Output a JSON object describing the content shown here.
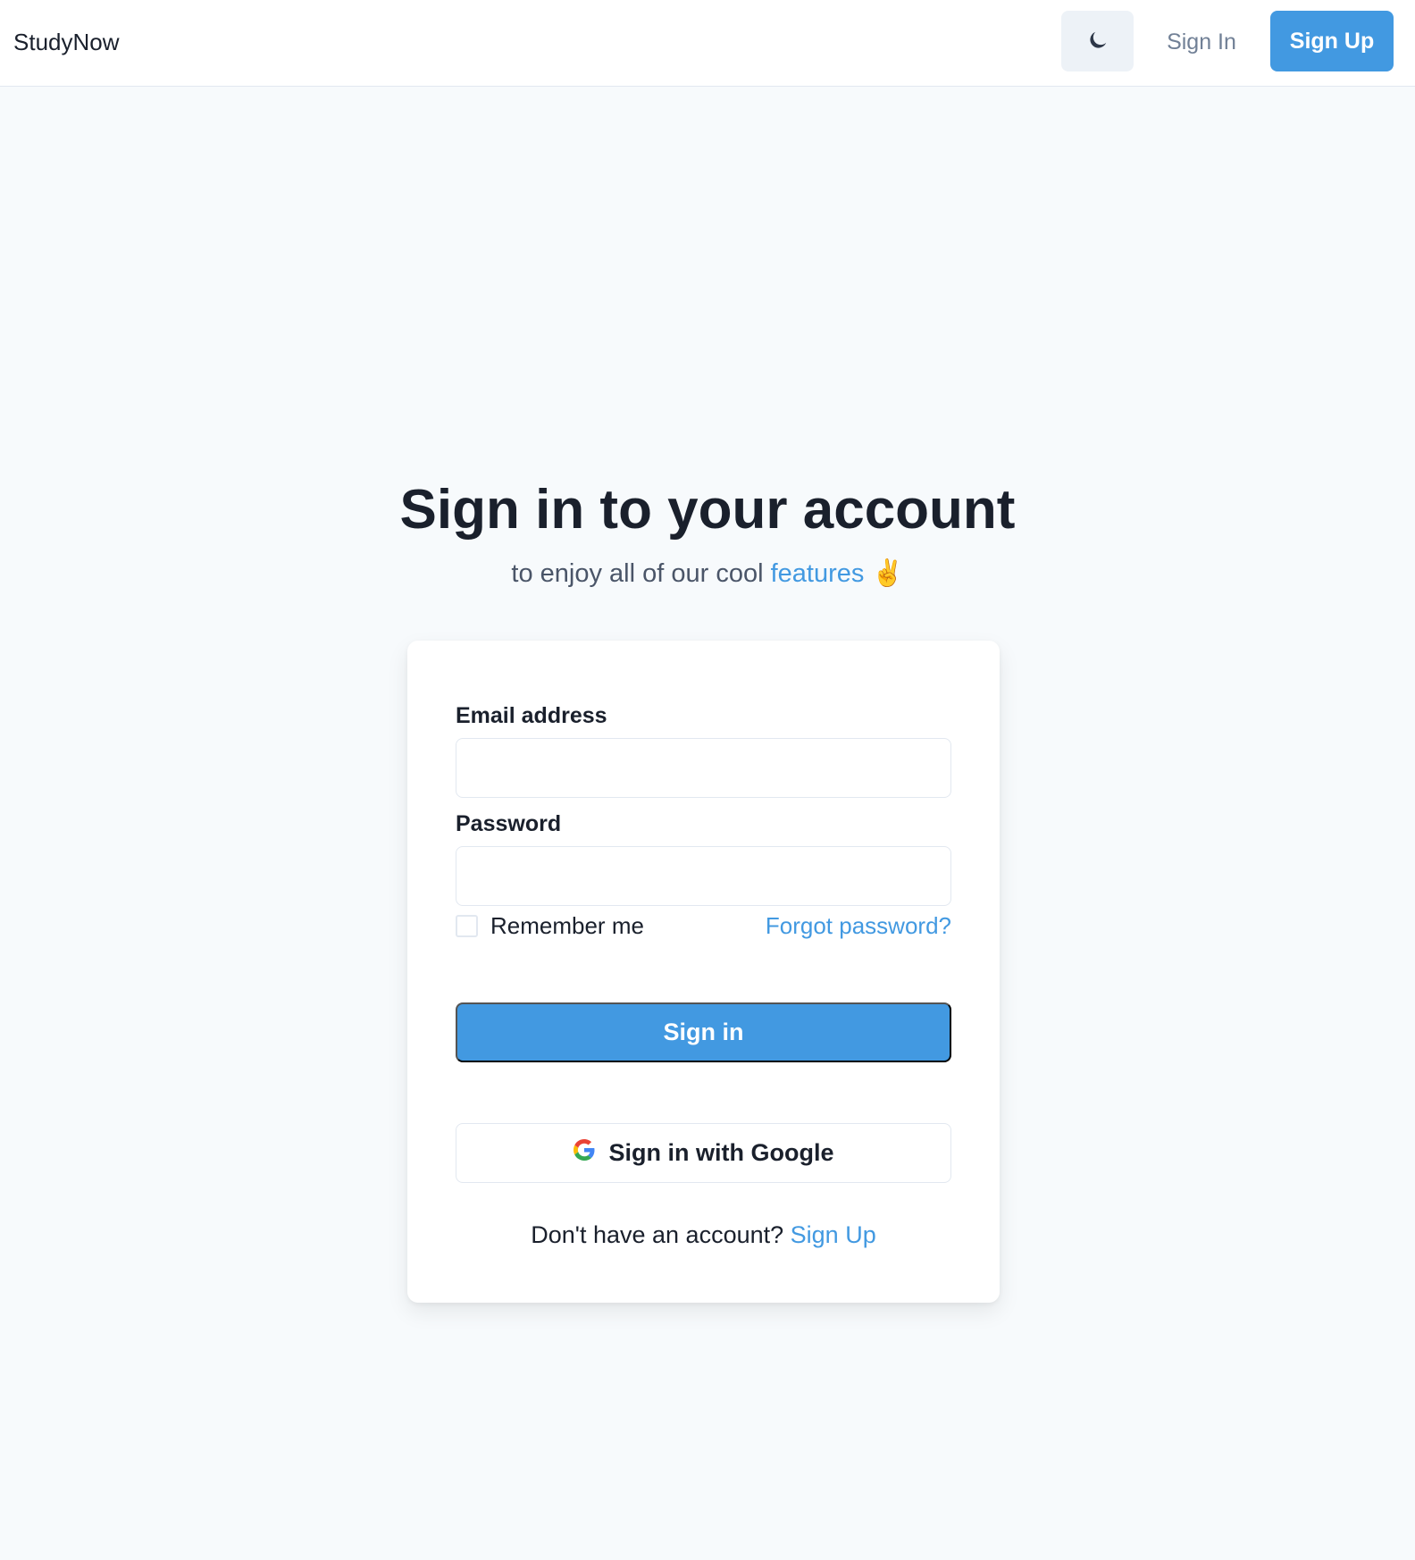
{
  "navbar": {
    "brand": "StudyNow",
    "theme_toggle_icon": "moon-icon",
    "signin_label": "Sign In",
    "signup_label": "Sign Up"
  },
  "hero": {
    "title": "Sign in to your account",
    "subtitle_prefix": "to enjoy all of our cool",
    "subtitle_link": "features",
    "subtitle_emoji": "✌️"
  },
  "form": {
    "email_label": "Email address",
    "email_value": "",
    "email_placeholder": "",
    "password_label": "Password",
    "password_value": "",
    "password_placeholder": "",
    "remember_label": "Remember me",
    "remember_checked": false,
    "forgot_label": "Forgot password?",
    "submit_label": "Sign in",
    "google_label": "Sign in with Google",
    "footer_prefix": "Don't have an account?",
    "footer_link": "Sign Up"
  },
  "colors": {
    "accent": "#4299e1",
    "background": "#f7fafc",
    "text": "#1a202c"
  }
}
